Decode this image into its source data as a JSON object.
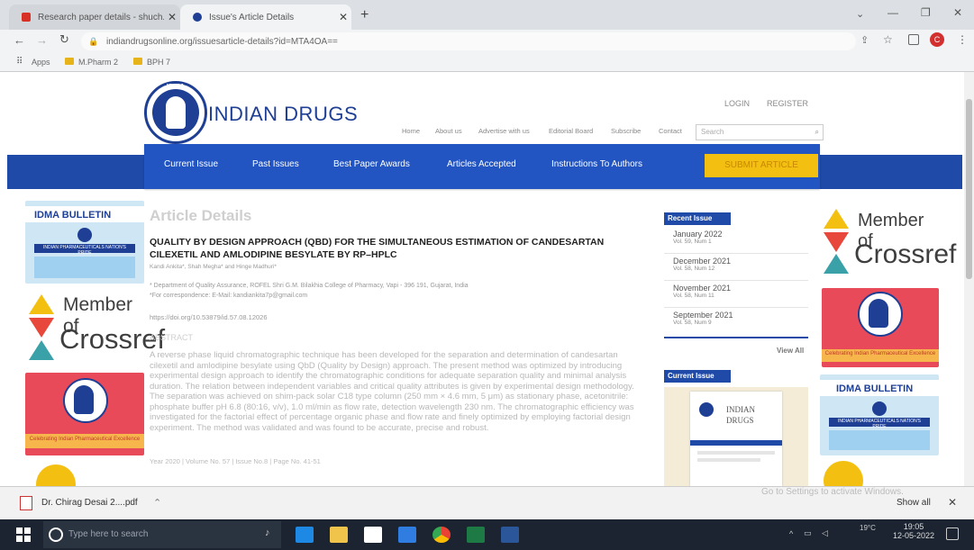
{
  "browser": {
    "tabs": [
      {
        "title": "Research paper details - shuch..."
      },
      {
        "title": "Issue's Article Details"
      }
    ],
    "new_tab": "+",
    "url": "indiandrugsonline.org/issuesarticle-details?id=MTA4OA==",
    "bookmarks": [
      "Apps",
      "M.Pharm 2",
      "BPH 7"
    ],
    "profile_initial": "C"
  },
  "site": {
    "name": "INDIAN DRUGS",
    "logo_text": "IDMA",
    "auth": [
      "LOGIN",
      "REGISTER"
    ],
    "top_links": [
      "Home",
      "About us",
      "Advertise with us",
      "Editorial Board",
      "Subscribe",
      "Contact"
    ],
    "search_placeholder": "Search",
    "main_nav": [
      "Current Issue",
      "Past Issues",
      "Best Paper Awards",
      "Articles Accepted",
      "Instructions To Authors"
    ],
    "submit_label": "SUBMIT ARTICLE"
  },
  "article": {
    "heading": "Article Details",
    "title": "QUALITY BY DESIGN APPROACH (QBD) FOR THE SIMULTANEOUS ESTIMATION OF CANDESARTAN CILEXETIL AND AMLODIPINE BESYLATE BY RP–HPLC",
    "authors": "Kandi Ankita*, Shah Megha* and Hinge Madhuri*",
    "affiliation": "* Department of Quality Assurance, ROFEL Shri G.M. Bilakhia College of Pharmacy, Vapi - 396 191, Gujarat, India",
    "correspondence": "*For correspondence: E-Mail: kandiankita7p@gmail.com",
    "doi": "https://doi.org/10.53879/id.57.08.12026",
    "abstract_heading": "ABSTRACT",
    "abstract": "A reverse phase liquid chromatographic technique has been developed for the separation and determination of candesartan cilexetil and amlodipine besylate using QbD (Quality by Design) approach. The present method was optimized by introducing experimental design approach to identify the chromatographic conditions for adequate separation quality and minimal analysis duration. The relation between independent variables and critical quality attributes is given by experimental design methodology. The separation was achieved on shim-pack solar C18 type column (250 mm × 4.6 mm, 5 μm) as stationary phase, acetonitrile: phosphate buffer pH 6.8 (80:16, v/v), 1.0 ml/min as flow rate, detection wavelength 230 nm. The chromatographic efficiency was investigated for the factorial effect of percentage organic phase and flow rate and finely optimized by employing factorial design experiment. The method was validated and was found to be accurate, precise and robust.",
    "footer_meta": "Year 2020 | Volume No. 57 | Issue No.8 | Page No. 41-51"
  },
  "sidebar": {
    "recent_heading": "Recent Issue",
    "recent": [
      {
        "month": "January 2022",
        "vol": "Vol. 59, Num 1"
      },
      {
        "month": "December 2021",
        "vol": "Vol. 58, Num 12"
      },
      {
        "month": "November 2021",
        "vol": "Vol. 58, Num 11"
      },
      {
        "month": "September 2021",
        "vol": "Vol. 58, Num 9"
      }
    ],
    "view_all": "View All",
    "current_heading": "Current Issue",
    "cover_title": "INDIAN DRUGS"
  },
  "ads": {
    "bulletin_title": "IDMA BULLETIN",
    "bulletin_sub": "INDIAN PHARMACEUTICALS NATION'S PRIDE",
    "crossref_top": "Member of",
    "crossref_bottom": "Crossref",
    "idma_banner": "Celebrating Indian Pharmaceutical Excellence"
  },
  "download": {
    "file": "Dr. Chirag Desai 2....pdf",
    "show_all": "Show all",
    "windows_watermark": "Go to Settings to activate Windows."
  },
  "taskbar": {
    "search_placeholder": "Type here to search",
    "weather": "19°C",
    "time": "19:05",
    "date": "12-05-2022"
  },
  "colors": {
    "navy": "#1e3f94",
    "gold": "#f3c012",
    "nav_blue": "#1f4aa8"
  }
}
